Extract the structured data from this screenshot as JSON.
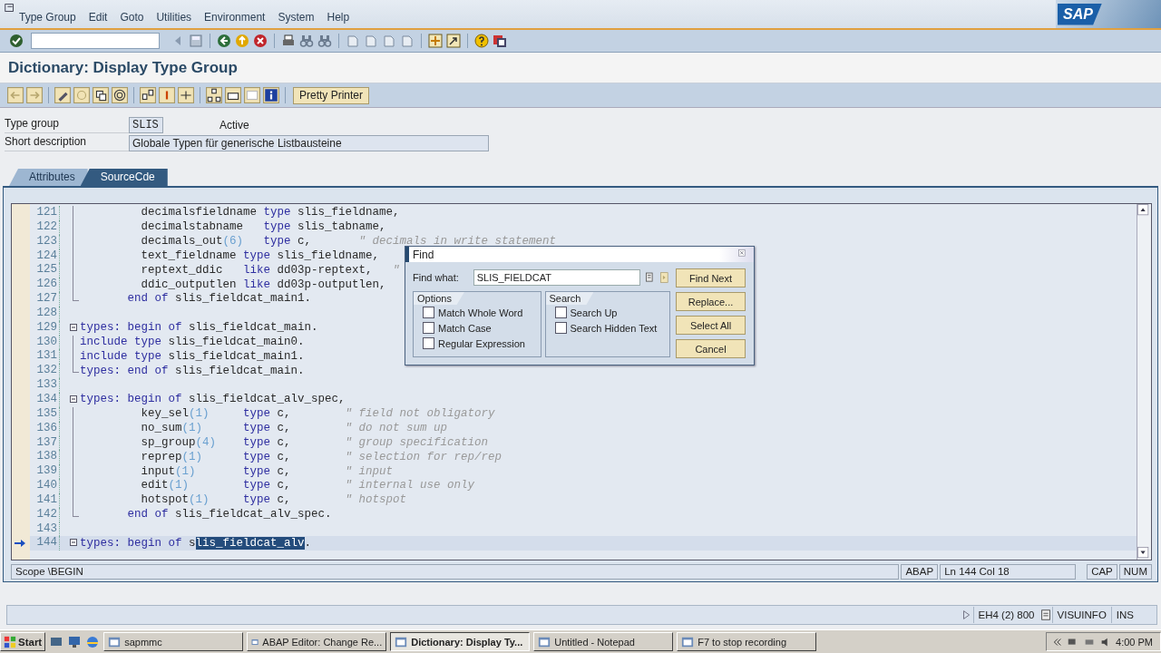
{
  "menu": [
    "Type Group",
    "Edit",
    "Goto",
    "Utilities",
    "Environment",
    "System",
    "Help"
  ],
  "logo": "SAP",
  "title": "Dictionary: Display Type Group",
  "app_toolbar": {
    "button": "Pretty Printer"
  },
  "fields": [
    {
      "label": "Type group",
      "value": "SLIS",
      "status": "Active"
    },
    {
      "label": "Short description",
      "value": "Globale Typen für generische Listbausteine"
    }
  ],
  "tabs": [
    {
      "label": "Attributes",
      "selected": false
    },
    {
      "label": "SourceCde",
      "selected": true
    }
  ],
  "editor": {
    "lines": [
      {
        "number": "121",
        "kind": "inner",
        "current": false,
        "segments": [
          {
            "kind": "plain",
            "text": "         decimalsfieldname "
          },
          {
            "kind": "keyword",
            "text": "type"
          },
          {
            "kind": "plain",
            "text": " slis_fieldname,"
          }
        ]
      },
      {
        "number": "122",
        "kind": "inner",
        "current": false,
        "segments": [
          {
            "kind": "plain",
            "text": "         decimalstabname   "
          },
          {
            "kind": "keyword",
            "text": "type"
          },
          {
            "kind": "plain",
            "text": " slis_tabname,"
          }
        ]
      },
      {
        "number": "123",
        "kind": "inner",
        "current": false,
        "segments": [
          {
            "kind": "plain",
            "text": "         decimals_out"
          },
          {
            "kind": "number",
            "text": "(6)   "
          },
          {
            "kind": "keyword",
            "text": "type"
          },
          {
            "kind": "plain",
            "text": " c,       "
          },
          {
            "kind": "comment",
            "text": "\" decimals in write statement"
          }
        ]
      },
      {
        "number": "124",
        "kind": "inner",
        "current": false,
        "segments": [
          {
            "kind": "plain",
            "text": "         text_fieldname "
          },
          {
            "kind": "keyword",
            "text": "type"
          },
          {
            "kind": "plain",
            "text": " slis_fieldname,"
          }
        ]
      },
      {
        "number": "125",
        "kind": "inner",
        "current": false,
        "segments": [
          {
            "kind": "plain",
            "text": "         reptext_ddic   "
          },
          {
            "kind": "keyword",
            "text": "like"
          },
          {
            "kind": "plain",
            "text": " dd03p-reptext,   "
          },
          {
            "kind": "comment",
            "text": "\""
          }
        ]
      },
      {
        "number": "126",
        "kind": "inner",
        "current": false,
        "segments": [
          {
            "kind": "plain",
            "text": "         ddic_outputlen "
          },
          {
            "kind": "keyword",
            "text": "like"
          },
          {
            "kind": "plain",
            "text": " dd03p-outputlen,"
          }
        ]
      },
      {
        "number": "127",
        "kind": "end",
        "current": false,
        "segments": [
          {
            "kind": "keyword",
            "text": "       end of"
          },
          {
            "kind": "plain",
            "text": " slis_fieldcat_main1."
          }
        ]
      },
      {
        "number": "128",
        "kind": "blank",
        "current": false
      },
      {
        "number": "129",
        "kind": "start",
        "current": false,
        "segments": [
          {
            "kind": "keyword",
            "text": "types: begin of"
          },
          {
            "kind": "plain",
            "text": " slis_fieldcat_main."
          }
        ]
      },
      {
        "number": "130",
        "kind": "inner",
        "current": false,
        "segments": [
          {
            "kind": "keyword",
            "text": "include type"
          },
          {
            "kind": "plain",
            "text": " slis_fieldcat_main0."
          }
        ]
      },
      {
        "number": "131",
        "kind": "inner",
        "current": false,
        "segments": [
          {
            "kind": "keyword",
            "text": "include type"
          },
          {
            "kind": "plain",
            "text": " slis_fieldcat_main1."
          }
        ]
      },
      {
        "number": "132",
        "kind": "end",
        "current": false,
        "segments": [
          {
            "kind": "keyword",
            "text": "types: end of"
          },
          {
            "kind": "plain",
            "text": " slis_fieldcat_main."
          }
        ]
      },
      {
        "number": "133",
        "kind": "blank",
        "current": false
      },
      {
        "number": "134",
        "kind": "start",
        "current": false,
        "segments": [
          {
            "kind": "keyword",
            "text": "types: begin of"
          },
          {
            "kind": "plain",
            "text": " slis_fieldcat_alv_spec,"
          }
        ]
      },
      {
        "number": "135",
        "kind": "inner",
        "current": false,
        "segments": [
          {
            "kind": "plain",
            "text": "         key_sel"
          },
          {
            "kind": "number",
            "text": "(1)     "
          },
          {
            "kind": "keyword",
            "text": "type"
          },
          {
            "kind": "plain",
            "text": " c,        "
          },
          {
            "kind": "comment",
            "text": "\" field not obligatory"
          }
        ]
      },
      {
        "number": "136",
        "kind": "inner",
        "current": false,
        "segments": [
          {
            "kind": "plain",
            "text": "         no_sum"
          },
          {
            "kind": "number",
            "text": "(1)      "
          },
          {
            "kind": "keyword",
            "text": "type"
          },
          {
            "kind": "plain",
            "text": " c,        "
          },
          {
            "kind": "comment",
            "text": "\" do not sum up"
          }
        ]
      },
      {
        "number": "137",
        "kind": "inner",
        "current": false,
        "segments": [
          {
            "kind": "plain",
            "text": "         sp_group"
          },
          {
            "kind": "number",
            "text": "(4)    "
          },
          {
            "kind": "keyword",
            "text": "type"
          },
          {
            "kind": "plain",
            "text": " c,        "
          },
          {
            "kind": "comment",
            "text": "\" group specification"
          }
        ]
      },
      {
        "number": "138",
        "kind": "inner",
        "current": false,
        "segments": [
          {
            "kind": "plain",
            "text": "         reprep"
          },
          {
            "kind": "number",
            "text": "(1)      "
          },
          {
            "kind": "keyword",
            "text": "type"
          },
          {
            "kind": "plain",
            "text": " c,        "
          },
          {
            "kind": "comment",
            "text": "\" selection for rep/rep"
          }
        ]
      },
      {
        "number": "139",
        "kind": "inner",
        "current": false,
        "segments": [
          {
            "kind": "plain",
            "text": "         input"
          },
          {
            "kind": "number",
            "text": "(1)       "
          },
          {
            "kind": "keyword",
            "text": "type"
          },
          {
            "kind": "plain",
            "text": " c,        "
          },
          {
            "kind": "comment",
            "text": "\" input"
          }
        ]
      },
      {
        "number": "140",
        "kind": "inner",
        "current": false,
        "segments": [
          {
            "kind": "plain",
            "text": "         edit"
          },
          {
            "kind": "number",
            "text": "(1)        "
          },
          {
            "kind": "keyword",
            "text": "type"
          },
          {
            "kind": "plain",
            "text": " c,        "
          },
          {
            "kind": "comment",
            "text": "\" internal use only"
          }
        ]
      },
      {
        "number": "141",
        "kind": "inner",
        "current": false,
        "segments": [
          {
            "kind": "plain",
            "text": "         hotspot"
          },
          {
            "kind": "number",
            "text": "(1)     "
          },
          {
            "kind": "keyword",
            "text": "type"
          },
          {
            "kind": "plain",
            "text": " c,        "
          },
          {
            "kind": "comment",
            "text": "\" hotspot"
          }
        ]
      },
      {
        "number": "142",
        "kind": "end",
        "current": false,
        "segments": [
          {
            "kind": "keyword",
            "text": "       end of"
          },
          {
            "kind": "plain",
            "text": " slis_fieldcat_alv_spec."
          }
        ]
      },
      {
        "number": "143",
        "kind": "blank",
        "current": false
      },
      {
        "number": "144",
        "kind": "start",
        "current": true,
        "segments": [
          {
            "kind": "keyword",
            "text": "types: begin of"
          },
          {
            "kind": "plain",
            "text": " s"
          },
          {
            "kind": "selection",
            "text": "lis_fieldcat_alv"
          },
          {
            "kind": "plain",
            "text": "."
          }
        ]
      }
    ],
    "status": {
      "scope": "Scope \\BEGIN",
      "language": "ABAP",
      "position": "Ln 144 Col  18",
      "caps": "CAP",
      "num": "NUM"
    }
  },
  "find_dialog": {
    "title": "Find",
    "find_label": "Find what:",
    "find_value": "SLIS_FIELDCAT",
    "groups": [
      {
        "title": "Options",
        "options": [
          {
            "label": "Match Whole Word",
            "checked": false
          },
          {
            "label": "Match Case",
            "checked": false
          },
          {
            "label": "Regular Expression",
            "checked": false
          }
        ]
      },
      {
        "title": "Search",
        "options": [
          {
            "label": "Search Up",
            "checked": false
          },
          {
            "label": "Search Hidden Text",
            "checked": false
          }
        ]
      }
    ],
    "buttons": [
      "Find Next",
      "Replace...",
      "Select All",
      "Cancel"
    ]
  },
  "status_bar": {
    "system": "EH4 (2) 800",
    "server": "VISUINFO",
    "mode": "INS"
  },
  "taskbar": {
    "start": "Start",
    "items": [
      {
        "label": "sapmmc",
        "selected": false
      },
      {
        "label": "ABAP Editor: Change Re...",
        "selected": false
      },
      {
        "label": "Dictionary: Display Ty...",
        "selected": true
      },
      {
        "label": "Untitled - Notepad",
        "selected": false
      },
      {
        "label": "F7 to stop recording",
        "selected": false
      }
    ],
    "clock": "4:00 PM"
  }
}
